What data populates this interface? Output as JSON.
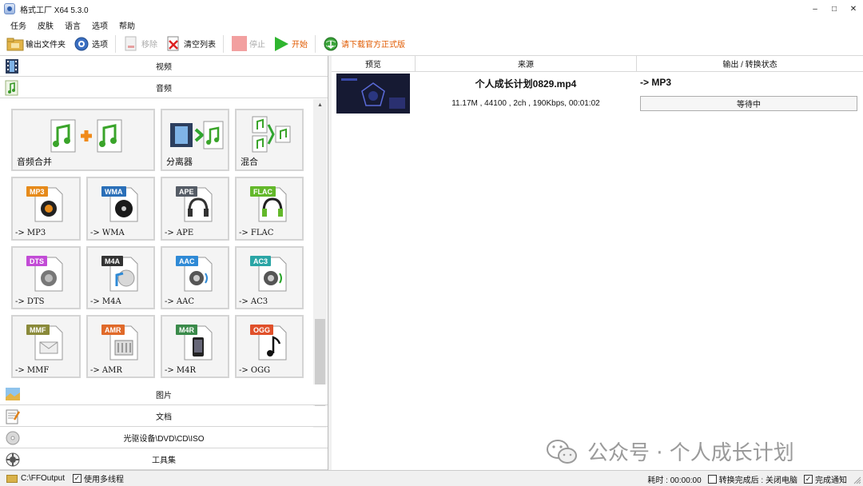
{
  "window": {
    "title": "格式工厂 X64 5.3.0",
    "minimize": "–",
    "maximize": "□",
    "close": "✕"
  },
  "menu": [
    "任务",
    "皮肤",
    "语言",
    "选项",
    "帮助"
  ],
  "toolbar": {
    "output_folder": "输出文件夹",
    "options": "选项",
    "remove": "移除",
    "clear_list": "清空列表",
    "stop": "停止",
    "start": "开始",
    "download_official": "请下载官方正式版"
  },
  "categories": {
    "video": "视频",
    "audio": "音频",
    "image": "图片",
    "document": "文档",
    "optical": "光驱设备\\DVD\\CD\\ISO",
    "tools": "工具集"
  },
  "audio_tools": {
    "merge": "音频合并",
    "splitter": "分离器",
    "mix": "混合"
  },
  "formats": [
    {
      "tag": "MP3",
      "label": "-> MP3",
      "color": "#e68a1a",
      "icon": "speaker-icon"
    },
    {
      "tag": "WMA",
      "label": "-> WMA",
      "color": "#2a6fb8",
      "icon": "disc-icon"
    },
    {
      "tag": "APE",
      "label": "-> APE",
      "color": "#555c66",
      "icon": "headphones-icon"
    },
    {
      "tag": "FLAC",
      "label": "-> FLAC",
      "color": "#63b82a",
      "icon": "headphones-icon"
    },
    {
      "tag": "DTS",
      "label": "-> DTS",
      "color": "#c24bd6",
      "icon": "speaker-icon"
    },
    {
      "tag": "M4A",
      "label": "-> M4A",
      "color": "#333333",
      "icon": "music-disc-icon"
    },
    {
      "tag": "AAC",
      "label": "-> AAC",
      "color": "#2f8ad6",
      "icon": "speaker-icon"
    },
    {
      "tag": "AC3",
      "label": "-> AC3",
      "color": "#2aa5a5",
      "icon": "speaker-icon"
    },
    {
      "tag": "MMF",
      "label": "-> MMF",
      "color": "#8a8a3a",
      "icon": "envelope-icon"
    },
    {
      "tag": "AMR",
      "label": "-> AMR",
      "color": "#e06a2a",
      "icon": "mixer-icon"
    },
    {
      "tag": "M4R",
      "label": "-> M4R",
      "color": "#3a8a4a",
      "icon": "phone-icon"
    },
    {
      "tag": "OGG",
      "label": "-> OGG",
      "color": "#e0502a",
      "icon": "note-icon"
    }
  ],
  "task_list": {
    "columns": [
      "预览",
      "来源",
      "输出 / 转换状态"
    ],
    "rows": [
      {
        "file_name": "个人成长计划0829.mp4",
        "info": "11.17M , 44100 , 2ch , 190Kbps, 00:01:02",
        "output": "-> MP3",
        "status": "等待中"
      }
    ]
  },
  "watermark": "公众号 · 个人成长计划",
  "statusbar": {
    "output_path": "C:\\FFOutput",
    "multithread": "使用多线程",
    "elapsed": "耗时 : 00:00:00",
    "after_done": "转换完成后 : 关闭电脑",
    "notify": "完成通知",
    "multithread_checked": true,
    "after_done_checked": false,
    "notify_checked": true
  }
}
